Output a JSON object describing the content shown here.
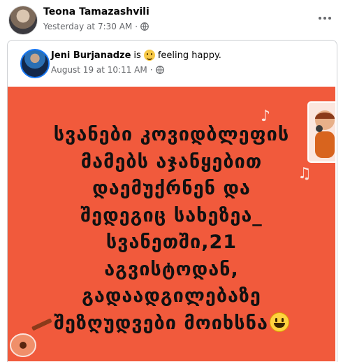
{
  "post": {
    "author": "Teona Tamazashvili",
    "timestamp": "Yesterday at 7:30 AM",
    "separator": "·",
    "privacy_icon": "globe-icon",
    "more_icon": "more-options-icon"
  },
  "shared_post": {
    "author": "Jeni Burjanadze",
    "is_text": "is",
    "feeling_icon": "smiling-face-icon",
    "feeling_text": "feeling happy.",
    "timestamp": "August 19 at 10:11 AM",
    "separator": "·",
    "privacy_icon": "globe-icon"
  },
  "image": {
    "background_color": "#f15a3c",
    "text_lines": [
      "სვანები კოვიდბლეფის",
      "მამებს აჯანყებით",
      "დაემუქრნენ და",
      "შედეგიც სახეზეა_",
      "სვანეთში,21",
      "აგვისტოდან,",
      "გადაადგილებაზე",
      "შეზღუდვები მოიხსნა"
    ],
    "trailing_emoji": "grinning-face-icon",
    "decorations": [
      "music-note-icon",
      "music-note-icon",
      "singer-illustration",
      "guitar-illustration"
    ]
  },
  "colors": {
    "accent": "#1877f2",
    "meta_gray": "#65676b",
    "text": "#050505"
  }
}
